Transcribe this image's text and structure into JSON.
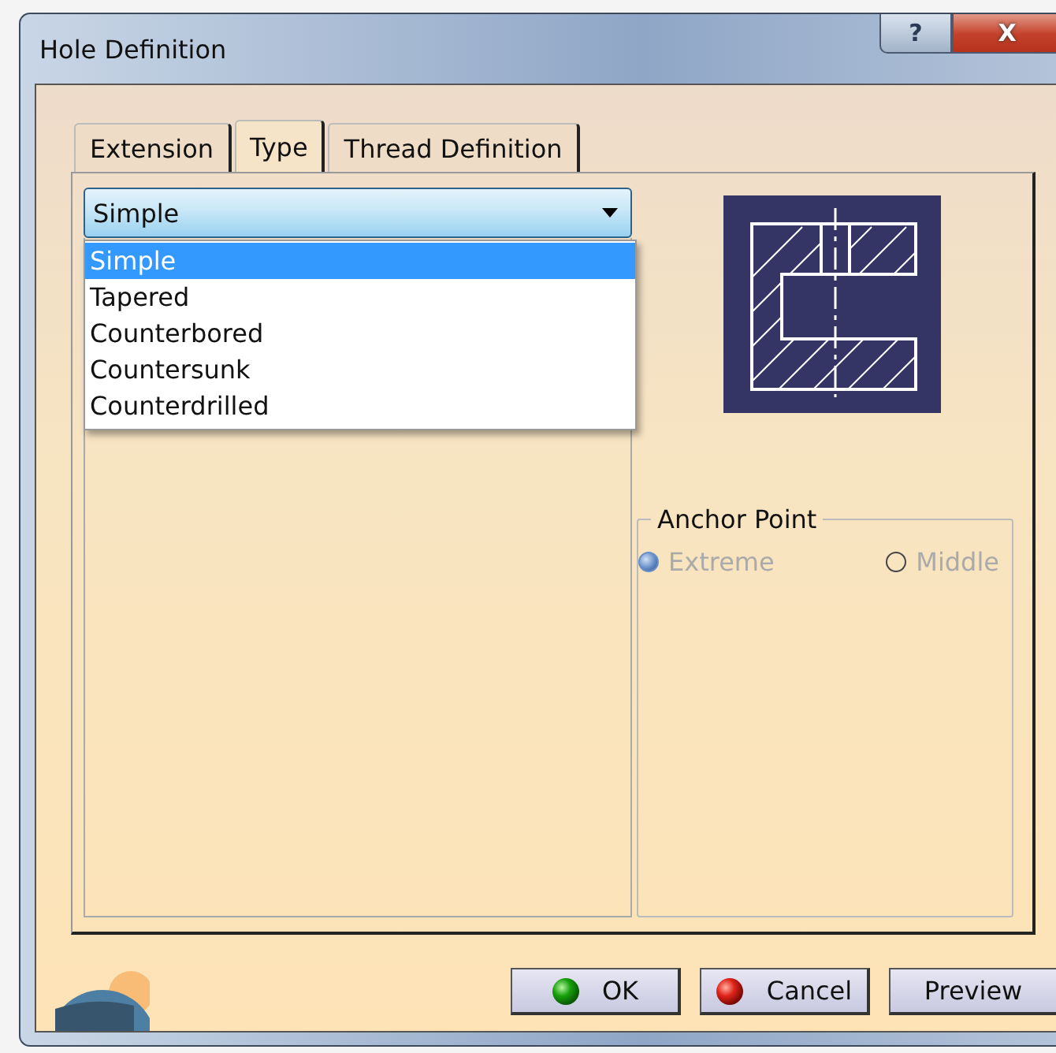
{
  "window": {
    "title": "Hole Definition",
    "help_button": "?",
    "close_button": "X"
  },
  "tabs": [
    {
      "label": "Extension",
      "selected": false
    },
    {
      "label": "Type",
      "selected": true
    },
    {
      "label": "Thread Definition",
      "selected": false
    }
  ],
  "type_dropdown": {
    "value": "Simple",
    "expanded": true,
    "options": [
      {
        "label": "Simple",
        "selected": true
      },
      {
        "label": "Tapered",
        "selected": false
      },
      {
        "label": "Counterbored",
        "selected": false
      },
      {
        "label": "Countersunk",
        "selected": false
      },
      {
        "label": "Counterdrilled",
        "selected": false
      }
    ]
  },
  "anchor_point": {
    "title": "Anchor Point",
    "options": [
      {
        "label": "Extreme",
        "selected": true,
        "disabled": true
      },
      {
        "label": "Middle",
        "selected": false,
        "disabled": true
      }
    ]
  },
  "buttons": [
    {
      "label": "OK",
      "kind": "ok"
    },
    {
      "label": "Cancel",
      "kind": "cancel"
    },
    {
      "label": "Preview",
      "kind": "plain"
    }
  ]
}
